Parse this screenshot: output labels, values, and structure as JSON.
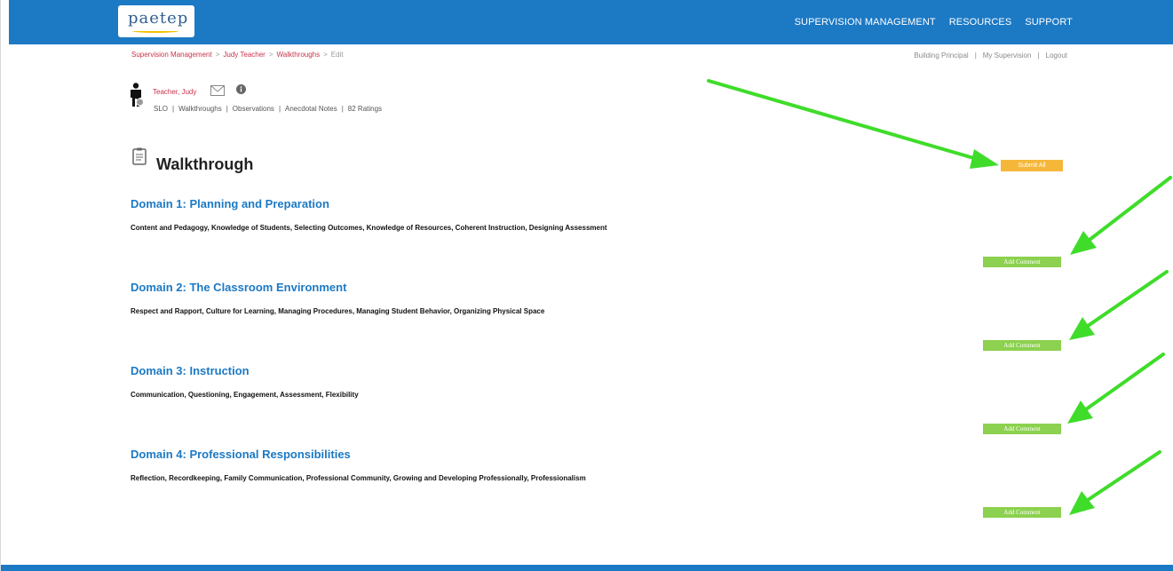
{
  "app": {
    "logo_text": "paetep"
  },
  "nav": {
    "items": [
      {
        "label": "SUPERVISION MANAGEMENT"
      },
      {
        "label": "RESOURCES"
      },
      {
        "label": "SUPPORT"
      }
    ]
  },
  "breadcrumb": {
    "items": [
      {
        "label": "Supervision Management"
      },
      {
        "label": "Judy Teacher"
      },
      {
        "label": "Walkthroughs"
      }
    ],
    "separator": ">",
    "current": "Edit"
  },
  "account": {
    "role": "Building Principal",
    "my_supervision": "My Supervision",
    "logout": "Logout",
    "separator": "|"
  },
  "teacher": {
    "name": "Teacher, Judy",
    "tabs": [
      {
        "label": "SLO"
      },
      {
        "label": "Walkthroughs"
      },
      {
        "label": "Observations"
      },
      {
        "label": "Anecdotal Notes"
      },
      {
        "label": "82 Ratings"
      }
    ],
    "tab_separator": "|"
  },
  "page": {
    "title": "Walkthrough",
    "submit_label": "Submit All"
  },
  "domains": [
    {
      "title": "Domain 1: Planning and Preparation",
      "description": "Content and Pedagogy, Knowledge of Students, Selecting Outcomes, Knowledge of Resources, Coherent Instruction, Designing Assessment",
      "button_label": "Add Comment"
    },
    {
      "title": "Domain 2: The Classroom Environment",
      "description": "Respect and Rapport, Culture for Learning, Managing Procedures, Managing Student Behavior, Organizing Physical Space",
      "button_label": "Add Comment"
    },
    {
      "title": "Domain 3: Instruction",
      "description": "Communication, Questioning, Engagement, Assessment, Flexibility",
      "button_label": "Add Comment"
    },
    {
      "title": "Domain 4: Professional Responsibilities",
      "description": "Reflection, Recordkeeping, Family Communication, Professional Community, Growing and Developing Professionally, Professionalism",
      "button_label": "Add Comment"
    }
  ],
  "icons": {
    "person": "person-icon",
    "mail": "mail-icon",
    "info": "info-icon",
    "clipboard": "clipboard-icon"
  },
  "colors": {
    "brand_blue": "#1c79c4",
    "link_red": "#c8334a",
    "submit_orange": "#f5b73a",
    "comment_green": "#8cd14f",
    "annotation_arrow": "#3fdc2a"
  }
}
